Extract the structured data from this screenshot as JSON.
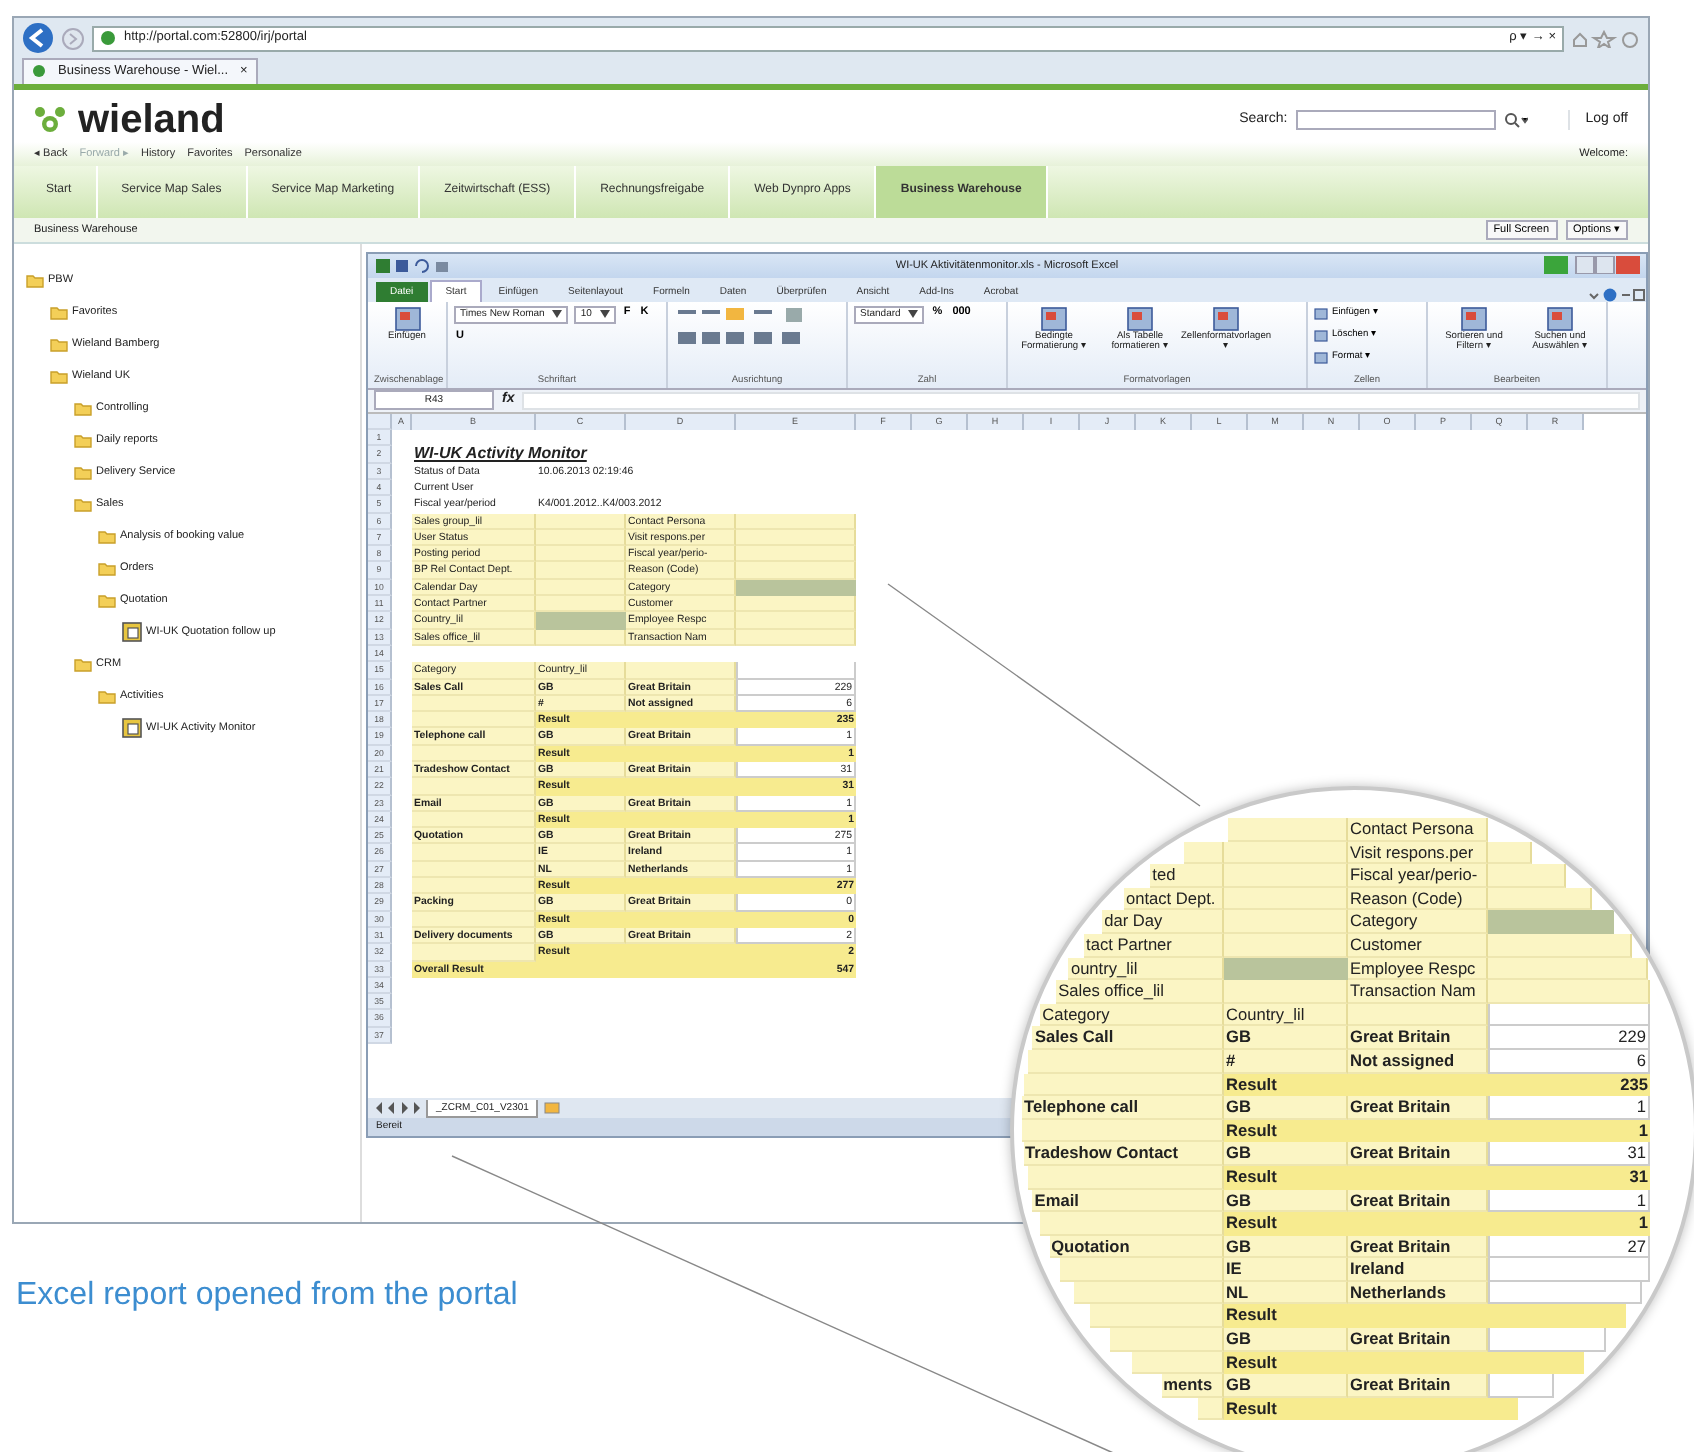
{
  "browser": {
    "url": "http://portal.com:52800/irj/portal",
    "search_controls": "ρ ▾ → ×",
    "tab_title": "Business Warehouse - Wiel...",
    "tab_close": "×"
  },
  "portal": {
    "logo": "wieland",
    "search_label": "Search:",
    "logoff": "Log off",
    "welcome": "Welcome:",
    "nav_links": [
      {
        "label": "◂ Back",
        "disabled": false
      },
      {
        "label": "Forward ▸",
        "disabled": true
      },
      {
        "label": "History",
        "disabled": false
      },
      {
        "label": "Favorites",
        "disabled": false
      },
      {
        "label": "Personalize",
        "disabled": false
      }
    ],
    "tabs": [
      {
        "label": "Start",
        "selected": false
      },
      {
        "label": "Service Map Sales",
        "selected": false
      },
      {
        "label": "Service Map Marketing",
        "selected": false
      },
      {
        "label": "Zeitwirtschaft (ESS)",
        "selected": false
      },
      {
        "label": "Rechnungsfreigabe",
        "selected": false
      },
      {
        "label": "Web Dynpro Apps",
        "selected": false
      },
      {
        "label": "Business Warehouse",
        "selected": true
      }
    ],
    "breadcrumb": "Business Warehouse",
    "buttons": [
      "Full Screen",
      "Options ▾"
    ]
  },
  "tree": [
    {
      "label": "PBW",
      "kind": "folder",
      "children": [
        {
          "label": "Favorites",
          "kind": "folder"
        },
        {
          "label": "Wieland Bamberg",
          "kind": "folder"
        },
        {
          "label": "Wieland UK",
          "kind": "folder",
          "children": [
            {
              "label": "Controlling",
              "kind": "folder"
            },
            {
              "label": "Daily reports",
              "kind": "folder"
            },
            {
              "label": "Delivery Service",
              "kind": "folder"
            },
            {
              "label": "Sales",
              "kind": "folder",
              "children": [
                {
                  "label": "Analysis of booking value",
                  "kind": "folder"
                },
                {
                  "label": "Orders",
                  "kind": "folder"
                },
                {
                  "label": "Quotation",
                  "kind": "folder",
                  "children": [
                    {
                      "label": "WI-UK Quotation follow up",
                      "kind": "report"
                    }
                  ]
                }
              ]
            },
            {
              "label": "CRM",
              "kind": "folder",
              "children": [
                {
                  "label": "Activities",
                  "kind": "folder",
                  "children": [
                    {
                      "label": "WI-UK Activity Monitor",
                      "kind": "report"
                    }
                  ]
                }
              ]
            }
          ]
        }
      ]
    }
  ],
  "excel": {
    "title": "WI-UK Aktivitätenmonitor.xls - Microsoft Excel",
    "menu_tabs": [
      {
        "label": "Datei",
        "kind": "file",
        "selected": false
      },
      {
        "label": "Start",
        "kind": "tab",
        "selected": true
      },
      {
        "label": "Einfügen",
        "kind": "tab",
        "selected": false
      },
      {
        "label": "Seitenlayout",
        "kind": "tab",
        "selected": false
      },
      {
        "label": "Formeln",
        "kind": "tab",
        "selected": false
      },
      {
        "label": "Daten",
        "kind": "tab",
        "selected": false
      },
      {
        "label": "Überprüfen",
        "kind": "tab",
        "selected": false
      },
      {
        "label": "Ansicht",
        "kind": "tab",
        "selected": false
      },
      {
        "label": "Add-Ins",
        "kind": "tab",
        "selected": false
      },
      {
        "label": "Acrobat",
        "kind": "tab",
        "selected": false
      }
    ],
    "ribbon": [
      {
        "name": "Zwischenablage",
        "items": [
          {
            "kind": "large",
            "label": "Einfügen"
          }
        ]
      },
      {
        "name": "Schriftart",
        "items": [
          {
            "kind": "dropdown",
            "label": "Times New Roman"
          },
          {
            "kind": "dropdown",
            "label": "10"
          },
          {
            "kind": "glyph",
            "label": "F"
          },
          {
            "kind": "glyph",
            "label": "K"
          },
          {
            "kind": "glyph",
            "label": "U"
          }
        ]
      },
      {
        "name": "Ausrichtung"
      },
      {
        "name": "Zahl",
        "items": [
          {
            "kind": "dropdown",
            "label": "Standard"
          },
          {
            "kind": "glyph",
            "label": "%"
          },
          {
            "kind": "glyph",
            "label": "000"
          }
        ]
      },
      {
        "name": "Formatvorlagen",
        "items": [
          {
            "kind": "large",
            "label": "Bedingte Formatierung ▾"
          },
          {
            "kind": "large",
            "label": "Als Tabelle formatieren ▾"
          },
          {
            "kind": "large",
            "label": "Zellenformatvorlagen ▾"
          }
        ]
      },
      {
        "name": "Zellen",
        "items": [
          {
            "kind": "small",
            "label": "Einfügen ▾"
          },
          {
            "kind": "small",
            "label": "Löschen ▾"
          },
          {
            "kind": "small",
            "label": "Format ▾"
          }
        ]
      },
      {
        "name": "Bearbeiten",
        "items": [
          {
            "kind": "large",
            "label": "Sortieren und Filtern ▾"
          },
          {
            "kind": "large",
            "label": "Suchen und Auswählen ▾"
          }
        ]
      }
    ],
    "name_box": "R43",
    "fx": "fx",
    "columns": [
      "A",
      "B",
      "C",
      "D",
      "E",
      "F",
      "G",
      "H",
      "I",
      "J",
      "K",
      "L",
      "M",
      "N",
      "O",
      "P",
      "Q",
      "R"
    ],
    "row_numbers": [
      "1",
      "2",
      "3",
      "4",
      "5",
      "6",
      "7",
      "8",
      "9",
      "10",
      "11",
      "12",
      "13",
      "14",
      "15",
      "16",
      "17",
      "18",
      "19",
      "20",
      "21",
      "22",
      "23",
      "24",
      "25",
      "26",
      "27",
      "28",
      "29",
      "30",
      "31",
      "32",
      "33",
      "34",
      "35",
      "36",
      "37"
    ],
    "report_title": "WI-UK Activity Monitor",
    "meta": [
      {
        "label": "Status of Data",
        "value": "10.06.2013 02:19:46"
      },
      {
        "label": "Current User"
      },
      {
        "label": "Fiscal year/period",
        "value": "K4/001.2012..K4/003.2012"
      }
    ],
    "filters": [
      {
        "left": "Sales group_lil",
        "left_set": false,
        "right": "Contact Persona",
        "right_set": false
      },
      {
        "left": "User Status",
        "left_set": false,
        "right": "Visit respons.per",
        "right_set": false
      },
      {
        "left": "Posting period",
        "left_set": false,
        "right": "Fiscal year/perio-",
        "right_set": false
      },
      {
        "left": "BP Rel Contact Dept.",
        "left_set": false,
        "right": "Reason (Code)",
        "right_set": false
      },
      {
        "left": "Calendar Day",
        "left_set": false,
        "right": "Category",
        "right_set": true
      },
      {
        "left": "Contact Partner",
        "left_set": false,
        "right": "Customer",
        "right_set": false
      },
      {
        "left": "Country_lil",
        "left_set": true,
        "right": "Employee Respc",
        "right_set": false
      },
      {
        "left": "Sales office_lil",
        "left_set": false,
        "right": "Transaction Nam",
        "right_set": false
      }
    ],
    "table_header": [
      "Category",
      "Country_lil"
    ],
    "rows": [
      {
        "kind": "data",
        "category": "Sales Call",
        "code": "GB",
        "country": "Great Britain",
        "value": "229"
      },
      {
        "kind": "data",
        "code": "#",
        "country": "Not assigned",
        "value": "6"
      },
      {
        "kind": "result",
        "code": "Result",
        "value": "235"
      },
      {
        "kind": "data",
        "category": "Telephone call",
        "code": "GB",
        "country": "Great Britain",
        "value": "1"
      },
      {
        "kind": "result",
        "code": "Result",
        "value": "1"
      },
      {
        "kind": "data",
        "category": "Tradeshow Contact",
        "code": "GB",
        "country": "Great Britain",
        "value": "31"
      },
      {
        "kind": "result",
        "code": "Result",
        "value": "31"
      },
      {
        "kind": "data",
        "category": "Email",
        "code": "GB",
        "country": "Great Britain",
        "value": "1"
      },
      {
        "kind": "result",
        "code": "Result",
        "value": "1"
      },
      {
        "kind": "data",
        "category": "Quotation",
        "code": "GB",
        "country": "Great Britain",
        "value": "275"
      },
      {
        "kind": "data",
        "code": "IE",
        "country": "Ireland",
        "value": "1"
      },
      {
        "kind": "data",
        "code": "NL",
        "country": "Netherlands",
        "value": "1"
      },
      {
        "kind": "result",
        "code": "Result",
        "value": "277"
      },
      {
        "kind": "data",
        "category": "Packing",
        "code": "GB",
        "country": "Great Britain",
        "value": "0"
      },
      {
        "kind": "result",
        "code": "Result",
        "value": "0"
      },
      {
        "kind": "data",
        "category": "Delivery documents",
        "code": "GB",
        "country": "Great Britain",
        "value": "2"
      },
      {
        "kind": "result",
        "code": "Result",
        "value": "2"
      },
      {
        "kind": "overall",
        "category": "Overall Result",
        "value": "547"
      }
    ],
    "sheet_tab": "_ZCRM_C01_V2301",
    "status": "Bereit"
  },
  "magnifier": {
    "filters": [
      {
        "right": "Contact Persona"
      },
      {
        "right": "Visit respons.per"
      },
      {
        "left": "ted",
        "right": "Fiscal year/perio-"
      },
      {
        "left": "ontact Dept.",
        "right": "Reason (Code)"
      },
      {
        "left": "dar Day",
        "right": "Category",
        "right_set": true
      },
      {
        "left": "tact Partner",
        "right": "Customer"
      },
      {
        "left": "ountry_lil",
        "left_set": true,
        "right": "Employee Respc"
      },
      {
        "left": "Sales office_lil",
        "right": "Transaction Nam"
      }
    ],
    "table_header": [
      "Category",
      "Country_lil"
    ],
    "rows": [
      {
        "kind": "data",
        "category": "Sales Call",
        "code": "GB",
        "country": "Great Britain",
        "value": "229"
      },
      {
        "kind": "data",
        "code": "#",
        "country": "Not assigned",
        "value": "6"
      },
      {
        "kind": "result",
        "code": "Result",
        "value": "235"
      },
      {
        "kind": "data",
        "category": "Telephone call",
        "code": "GB",
        "country": "Great Britain",
        "value": "1"
      },
      {
        "kind": "result",
        "code": "Result",
        "value": "1"
      },
      {
        "kind": "data",
        "category": "Tradeshow Contact",
        "code": "GB",
        "country": "Great Britain",
        "value": "31"
      },
      {
        "kind": "result",
        "code": "Result",
        "value": "31"
      },
      {
        "kind": "data",
        "category": "Email",
        "code": "GB",
        "country": "Great Britain",
        "value": "1"
      },
      {
        "kind": "result",
        "code": "Result",
        "value": "1"
      },
      {
        "kind": "data",
        "category": "Quotation",
        "code": "GB",
        "country": "Great Britain",
        "value": "27"
      },
      {
        "kind": "data",
        "code": "IE",
        "country": "Ireland"
      },
      {
        "kind": "data",
        "code": "NL",
        "country": "Netherlands"
      },
      {
        "kind": "result",
        "code": "Result"
      },
      {
        "kind": "data",
        "code": "GB",
        "country": "Great Britain"
      },
      {
        "kind": "result",
        "code": "Result"
      },
      {
        "kind": "data",
        "category": "ments",
        "code": "GB",
        "country": "Great Britain"
      },
      {
        "kind": "result",
        "code": "Result"
      }
    ]
  },
  "caption": "Excel report opened from the portal"
}
